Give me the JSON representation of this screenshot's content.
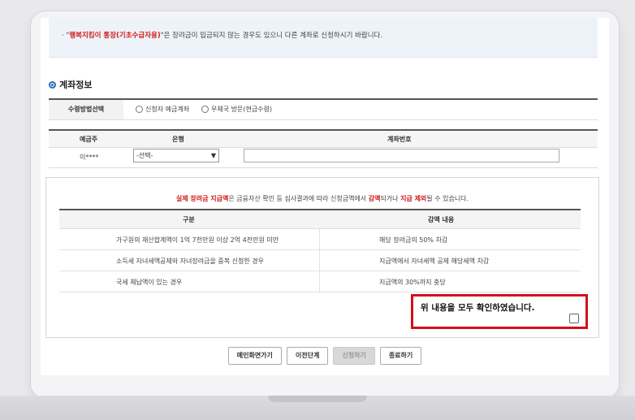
{
  "notice": {
    "prefix": "· \"",
    "highlight": "행복지킴이 통장(기초수급자용)",
    "suffix": "\"은 장려금이 입금되지 않는 경우도 있으니 다른 계좌로 신청하시기 바랍니다."
  },
  "section": {
    "title": "계좌정보"
  },
  "method": {
    "label": "수령방법선택",
    "option1": "신청자 예금계좌",
    "option2": "우체국 방문(현금수령)"
  },
  "account": {
    "col_holder": "예금주",
    "col_bank": "은행",
    "col_number": "계좌번호",
    "holder_value": "이****",
    "bank_selected": "-선택-"
  },
  "reduction": {
    "note_parts": [
      "실제 장려금 지급액",
      "은 금융자산 확인 등 심사결과에 따라 신청금액에서 ",
      "감액",
      "되거나 ",
      "지급 제외",
      "될 수 있습니다."
    ],
    "col_type": "구분",
    "col_detail": "감액 내용",
    "rows": [
      {
        "type": "가구원의 재산합계액이 1억 7천만원 이상 2억 4천만원 미만",
        "detail": "해당 장려금의 50% 차감"
      },
      {
        "type": "소득세 자녀세액공제와 자녀장려금을 중복 신청한 경우",
        "detail": "지급액에서 자녀세액 공제 해당세액 차감"
      },
      {
        "type": "국세 체납액이 있는 경우",
        "detail": "지급액의 30%까지 충당"
      }
    ]
  },
  "confirm": {
    "text": "위 내용을 모두 확인하였습니다."
  },
  "buttons": {
    "main": "메인화면가기",
    "prev": "이전단계",
    "apply": "신청하기",
    "exit": "종료하기"
  },
  "colors": {
    "accent_red": "#d40f1c",
    "bullet_blue": "#2f6fb5"
  }
}
